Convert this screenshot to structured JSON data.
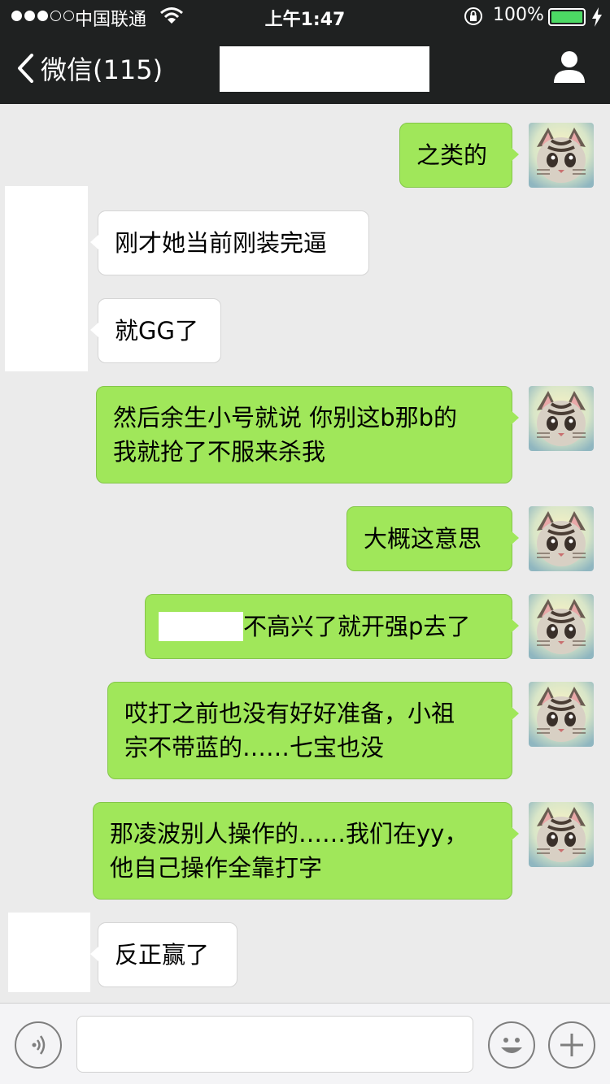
{
  "status_bar": {
    "carrier": "中国联通",
    "time": "上午1:47",
    "battery_percent": "100%",
    "signal_bars_filled": 3,
    "signal_bars_total": 5,
    "battery_color": "#4cd964"
  },
  "nav": {
    "back_label": "微信(115)",
    "back_icon": "chevron-left-icon",
    "profile_icon": "person-icon",
    "title_redacted": true
  },
  "messages": [
    {
      "side": "out",
      "lines": [
        "之类的"
      ]
    },
    {
      "side": "in",
      "lines": [
        "刚才她当前刚装完逼"
      ]
    },
    {
      "side": "in",
      "lines": [
        "就GG了"
      ]
    },
    {
      "side": "out",
      "lines": [
        "然后余生小号就说 你别这b那b的",
        "我就抢了不服来杀我"
      ]
    },
    {
      "side": "out",
      "lines": [
        "大概这意思"
      ]
    },
    {
      "side": "out",
      "prefix_redacted": true,
      "lines": [
        "不高兴了就开强p去了"
      ]
    },
    {
      "side": "out",
      "lines": [
        "哎打之前也没有好好准备，小祖",
        "宗不带蓝的……七宝也没"
      ]
    },
    {
      "side": "out",
      "lines": [
        "那凌波别人操作的……我们在yy，",
        "他自己操作全靠打字"
      ]
    },
    {
      "side": "in",
      "lines": [
        "反正赢了"
      ]
    }
  ],
  "messages_text": {
    "m0": "之类的",
    "m1": "刚才她当前刚装完逼",
    "m2": "就GG了",
    "m3": "然后余生小号就说 你别这b那b的\n我就抢了不服来杀我",
    "m4": "大概这意思",
    "m5": "不高兴了就开强p去了",
    "m6": "哎打之前也没有好好准备，小祖\n宗不带蓝的……七宝也没",
    "m7": "那凌波别人操作的……我们在yy，\n他自己操作全靠打字",
    "m8": "反正赢了"
  },
  "colors": {
    "outgoing_bubble": "#a0e75a",
    "incoming_bubble": "#ffffff",
    "chat_background": "#ebebeb",
    "nav_background": "#1f2121"
  },
  "input_bar": {
    "text_value": "",
    "voice_icon": "voice-icon",
    "emoji_icon": "emoji-icon",
    "plus_icon": "plus-icon"
  }
}
